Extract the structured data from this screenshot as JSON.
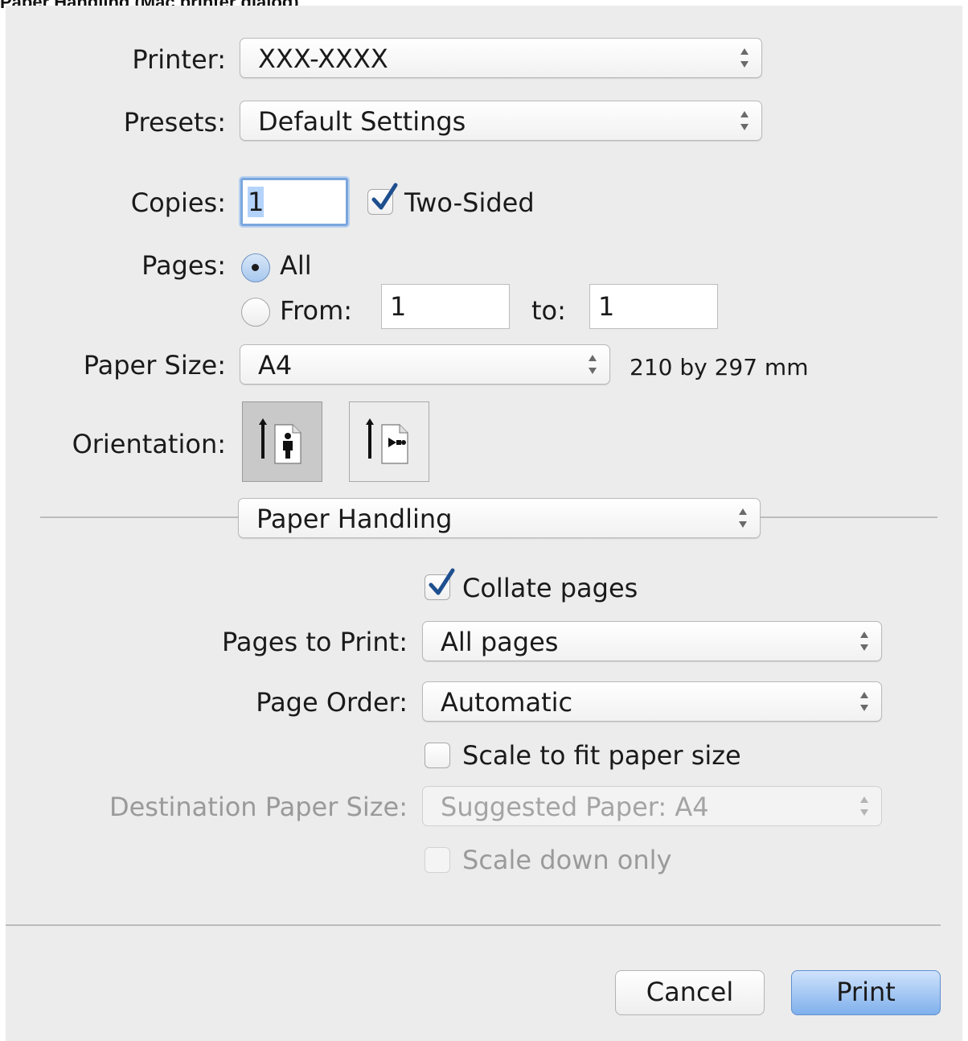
{
  "caption": "Paper Handling (Mac printer dialog)",
  "printer": {
    "label": "Printer:",
    "value": "XXX-XXXX"
  },
  "presets": {
    "label": "Presets:",
    "value": "Default Settings"
  },
  "copies": {
    "label": "Copies:",
    "value": "1",
    "two_sided_label": "Two-Sided",
    "two_sided_checked": true
  },
  "pages": {
    "label": "Pages:",
    "all_label": "All",
    "from_label": "From:",
    "from_value": "1",
    "to_label": "to:",
    "to_value": "1",
    "selected": "All"
  },
  "paper_size": {
    "label": "Paper Size:",
    "value": "A4",
    "dimensions": "210 by 297 mm"
  },
  "orientation": {
    "label": "Orientation:",
    "selected": "portrait"
  },
  "section_popup": {
    "value": "Paper Handling"
  },
  "paper_handling": {
    "collate_label": "Collate pages",
    "collate_checked": true,
    "pages_to_print_label": "Pages to Print:",
    "pages_to_print_value": "All pages",
    "page_order_label": "Page Order:",
    "page_order_value": "Automatic",
    "scale_fit_label": "Scale to fit paper size",
    "scale_fit_checked": false,
    "dest_paper_label": "Destination Paper Size:",
    "dest_paper_value": "Suggested Paper: A4",
    "scale_down_label": "Scale down only",
    "scale_down_checked": false
  },
  "buttons": {
    "cancel": "Cancel",
    "print": "Print"
  },
  "colors": {
    "dialog_bg": "#ececec",
    "accent": "#7fb0ec",
    "disabled_text": "#9a9a9a"
  }
}
